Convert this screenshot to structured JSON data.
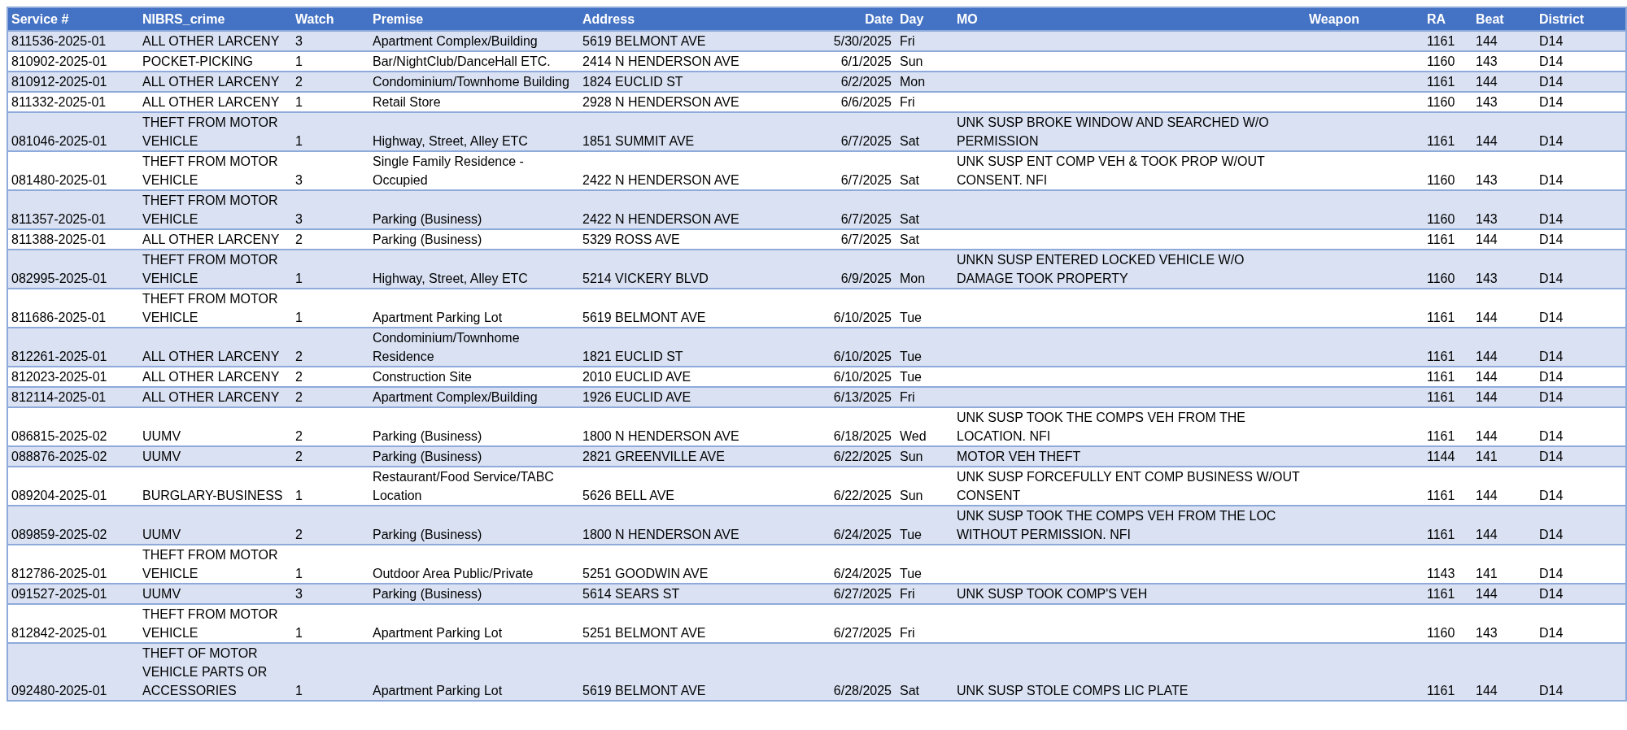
{
  "table": {
    "columns": [
      "Service #",
      "NIBRS_crime",
      "Watch",
      "Premise",
      "Address",
      "Date",
      "Day",
      "MO",
      "Weapon",
      "RA",
      "Beat",
      "District"
    ],
    "rows": [
      {
        "service": "811536-2025-01",
        "nibrs_crime": "ALL OTHER LARCENY",
        "watch": "3",
        "premise": "Apartment Complex/Building",
        "address": "5619 BELMONT AVE",
        "date": "5/30/2025",
        "day": "Fri",
        "ra": "1161",
        "beat": "144",
        "district": "D14"
      },
      {
        "service": "810902-2025-01",
        "nibrs_crime": "POCKET-PICKING",
        "watch": "1",
        "premise": "Bar/NightClub/DanceHall ETC.",
        "address": "2414 N HENDERSON AVE",
        "date": "6/1/2025",
        "day": "Sun",
        "ra": "1160",
        "beat": "143",
        "district": "D14"
      },
      {
        "service": "810912-2025-01",
        "nibrs_crime": "ALL OTHER LARCENY",
        "watch": "2",
        "premise": "Condominium/Townhome Building",
        "address": "1824 EUCLID ST",
        "date": "6/2/2025",
        "day": "Mon",
        "ra": "1161",
        "beat": "144",
        "district": "D14"
      },
      {
        "service": "811332-2025-01",
        "nibrs_crime": "ALL OTHER LARCENY",
        "watch": "1",
        "premise": "Retail Store",
        "address": "2928 N HENDERSON AVE",
        "date": "6/6/2025",
        "day": "Fri",
        "ra": "1160",
        "beat": "143",
        "district": "D14"
      },
      {
        "service": "081046-2025-01",
        "nibrs_crime": "THEFT FROM MOTOR VEHICLE",
        "watch": "1",
        "premise": "Highway, Street, Alley ETC",
        "address": "1851 SUMMIT AVE",
        "date": "6/7/2025",
        "day": "Sat",
        "mo": "UNK SUSP BROKE WINDOW AND SEARCHED W/O PERMISSION",
        "ra": "1161",
        "beat": "144",
        "district": "D14"
      },
      {
        "service": "081480-2025-01",
        "nibrs_crime": "THEFT FROM MOTOR VEHICLE",
        "watch": "3",
        "premise": "Single Family Residence - Occupied",
        "address": "2422 N HENDERSON AVE",
        "date": "6/7/2025",
        "day": "Sat",
        "mo": "UNK SUSP ENT COMP VEH & TOOK PROP W/OUT CONSENT. NFI",
        "ra": "1160",
        "beat": "143",
        "district": "D14"
      },
      {
        "service": "811357-2025-01",
        "nibrs_crime": "THEFT FROM MOTOR VEHICLE",
        "watch": "3",
        "premise": "Parking (Business)",
        "address": "2422 N HENDERSON AVE",
        "date": "6/7/2025",
        "day": "Sat",
        "ra": "1160",
        "beat": "143",
        "district": "D14"
      },
      {
        "service": "811388-2025-01",
        "nibrs_crime": "ALL OTHER LARCENY",
        "watch": "2",
        "premise": "Parking (Business)",
        "address": "5329 ROSS AVE",
        "date": "6/7/2025",
        "day": "Sat",
        "ra": "1161",
        "beat": "144",
        "district": "D14"
      },
      {
        "service": "082995-2025-01",
        "nibrs_crime": "THEFT FROM MOTOR VEHICLE",
        "watch": "1",
        "premise": "Highway, Street, Alley ETC",
        "address": "5214 VICKERY BLVD",
        "date": "6/9/2025",
        "day": "Mon",
        "mo": "UNKN SUSP ENTERED LOCKED VEHICLE W/O DAMAGE TOOK PROPERTY",
        "ra": "1160",
        "beat": "143",
        "district": "D14"
      },
      {
        "service": "811686-2025-01",
        "nibrs_crime": "THEFT FROM MOTOR VEHICLE",
        "watch": "1",
        "premise": "Apartment Parking Lot",
        "address": "5619 BELMONT AVE",
        "date": "6/10/2025",
        "day": "Tue",
        "ra": "1161",
        "beat": "144",
        "district": "D14"
      },
      {
        "service": "812261-2025-01",
        "nibrs_crime": "ALL OTHER LARCENY",
        "watch": "2",
        "premise": "Condominium/Townhome Residence",
        "address": "1821 EUCLID ST",
        "date": "6/10/2025",
        "day": "Tue",
        "ra": "1161",
        "beat": "144",
        "district": "D14"
      },
      {
        "service": "812023-2025-01",
        "nibrs_crime": "ALL OTHER LARCENY",
        "watch": "2",
        "premise": "Construction Site",
        "address": "2010 EUCLID AVE",
        "date": "6/10/2025",
        "day": "Tue",
        "ra": "1161",
        "beat": "144",
        "district": "D14"
      },
      {
        "service": "812114-2025-01",
        "nibrs_crime": "ALL OTHER LARCENY",
        "watch": "2",
        "premise": "Apartment Complex/Building",
        "address": "1926 EUCLID AVE",
        "date": "6/13/2025",
        "day": "Fri",
        "ra": "1161",
        "beat": "144",
        "district": "D14"
      },
      {
        "service": "086815-2025-02",
        "nibrs_crime": "UUMV",
        "watch": "2",
        "premise": "Parking (Business)",
        "address": "1800 N HENDERSON AVE",
        "date": "6/18/2025",
        "day": "Wed",
        "mo": "UNK SUSP TOOK THE COMPS VEH FROM THE LOCATION. NFI",
        "ra": "1161",
        "beat": "144",
        "district": "D14"
      },
      {
        "service": "088876-2025-02",
        "nibrs_crime": "UUMV",
        "watch": "2",
        "premise": "Parking (Business)",
        "address": "2821 GREENVILLE AVE",
        "date": "6/22/2025",
        "day": "Sun",
        "mo": "MOTOR VEH THEFT",
        "ra": "1144",
        "beat": "141",
        "district": "D14"
      },
      {
        "service": "089204-2025-01",
        "nibrs_crime": "BURGLARY-BUSINESS",
        "watch": "1",
        "premise": "Restaurant/Food Service/TABC Location",
        "address": "5626 BELL AVE",
        "date": "6/22/2025",
        "day": "Sun",
        "mo": "UNK SUSP FORCEFULLY ENT COMP BUSINESS W/OUT CONSENT",
        "ra": "1161",
        "beat": "144",
        "district": "D14"
      },
      {
        "service": "089859-2025-02",
        "nibrs_crime": "UUMV",
        "watch": "2",
        "premise": "Parking (Business)",
        "address": "1800 N HENDERSON AVE",
        "date": "6/24/2025",
        "day": "Tue",
        "mo": "UNK SUSP TOOK THE COMPS VEH FROM THE LOC WITHOUT PERMISSION. NFI",
        "ra": "1161",
        "beat": "144",
        "district": "D14"
      },
      {
        "service": "812786-2025-01",
        "nibrs_crime": "THEFT FROM MOTOR VEHICLE",
        "watch": "1",
        "premise": "Outdoor Area Public/Private",
        "address": "5251 GOODWIN AVE",
        "date": "6/24/2025",
        "day": "Tue",
        "ra": "1143",
        "beat": "141",
        "district": "D14"
      },
      {
        "service": "091527-2025-01",
        "nibrs_crime": "UUMV",
        "watch": "3",
        "premise": "Parking (Business)",
        "address": "5614 SEARS ST",
        "date": "6/27/2025",
        "day": "Fri",
        "mo": "UNK SUSP TOOK COMP'S VEH",
        "ra": "1161",
        "beat": "144",
        "district": "D14"
      },
      {
        "service": "812842-2025-01",
        "nibrs_crime": "THEFT FROM MOTOR VEHICLE",
        "watch": "1",
        "premise": "Apartment Parking Lot",
        "address": "5251 BELMONT AVE",
        "date": "6/27/2025",
        "day": "Fri",
        "ra": "1160",
        "beat": "143",
        "district": "D14"
      },
      {
        "service": "092480-2025-01",
        "nibrs_crime": "THEFT OF MOTOR VEHICLE PARTS OR ACCESSORIES",
        "watch": "1",
        "premise": "Apartment Parking Lot",
        "address": "5619 BELMONT AVE",
        "date": "6/28/2025",
        "day": "Sat",
        "mo": "UNK SUSP STOLE COMPS LIC PLATE",
        "ra": "1161",
        "beat": "144",
        "district": "D14"
      }
    ]
  }
}
